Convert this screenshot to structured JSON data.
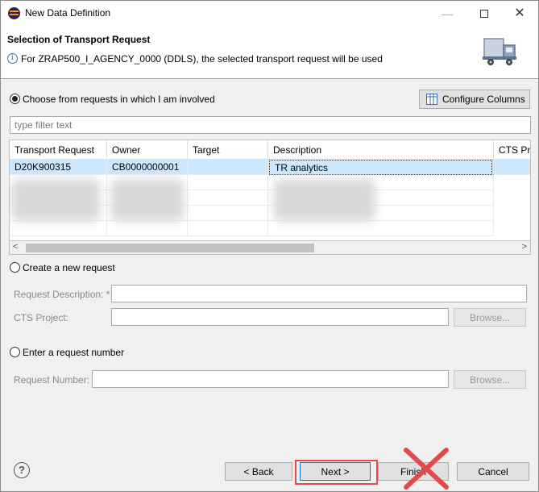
{
  "window": {
    "title": "New Data Definition",
    "minimize": "—",
    "close": "✕"
  },
  "header": {
    "title": "Selection of Transport Request",
    "info_icon": "i",
    "message": "For ZRAP500_I_AGENCY_0000 (DDLS), the selected transport request will be used"
  },
  "choose": {
    "label": "Choose from requests in which I am involved",
    "configure_columns": "Configure Columns",
    "filter_placeholder": "type filter text"
  },
  "table": {
    "columns": [
      "Transport Request",
      "Owner",
      "Target",
      "Description",
      "CTS Project"
    ],
    "rows": [
      {
        "request": "D20K900315",
        "owner": "CB0000000001",
        "target": "",
        "description": "TR analytics",
        "cts": ""
      }
    ]
  },
  "scrollbar": {
    "left": "<",
    "right": ">"
  },
  "create": {
    "label": "Create a new request",
    "desc_label": "Request Description: *",
    "cts_label": "CTS Project:",
    "browse": "Browse..."
  },
  "enter": {
    "label": "Enter a request number",
    "number_label": "Request Number:",
    "browse": "Browse..."
  },
  "footer": {
    "help": "?",
    "back": "< Back",
    "next": "Next >",
    "finish": "Finish",
    "cancel": "Cancel"
  },
  "colors": {
    "accent": "#0078d7",
    "annotation_red": "#e24b4b",
    "selected_row": "#cce8ff"
  }
}
